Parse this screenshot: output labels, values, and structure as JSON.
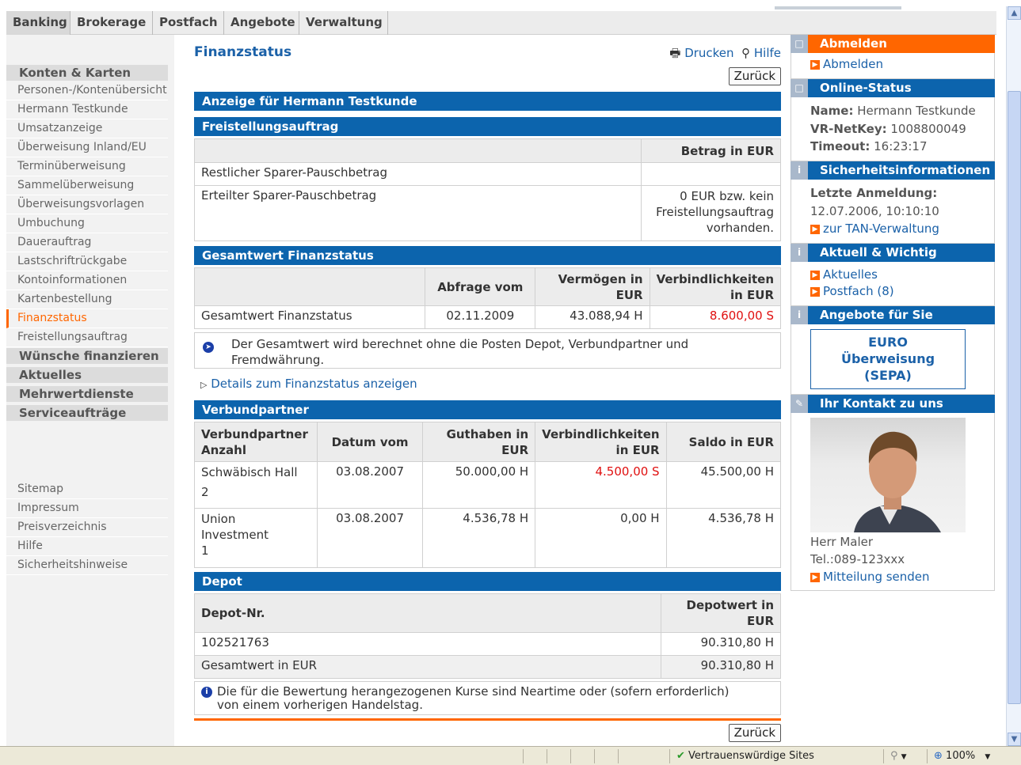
{
  "topnav": {
    "tabs": [
      "Banking",
      "Brokerage",
      "Postfach",
      "Angebote",
      "Verwaltung"
    ]
  },
  "sidebar": {
    "section1": "Konten & Karten",
    "items": [
      "Personen-/Kontenübersicht",
      "Hermann Testkunde",
      "Umsatzanzeige",
      "Überweisung Inland/EU",
      "Terminüberweisung",
      "Sammelüberweisung",
      "Überweisungsvorlagen",
      "Umbuchung",
      "Dauerauftrag",
      "Lastschriftrückgabe",
      "Kontoinformationen",
      "Kartenbestellung",
      "Finanzstatus",
      "Freistellungsauftrag"
    ],
    "active_index": 12,
    "sections": [
      "Wünsche finanzieren",
      "Aktuelles",
      "Mehrwertdienste",
      "Serviceaufträge"
    ],
    "footer_items": [
      "Sitemap",
      "Impressum",
      "Preisverzeichnis",
      "Hilfe",
      "Sicherheitshinweise"
    ]
  },
  "main": {
    "title": "Finanzstatus",
    "print": "Drucken",
    "help": "Hilfe",
    "back": "Zurück",
    "header_bar": "Anzeige für Hermann Testkunde",
    "freistellung": {
      "title": "Freistellungsauftrag",
      "col_betrag": "Betrag in EUR",
      "row1_label": "Restlicher Sparer-Pauschbetrag",
      "row1_value": "",
      "row2_label": "Erteilter Sparer-Pauschbetrag",
      "row2_value_l1": "0 EUR bzw. kein",
      "row2_value_l2": "Freistellungsauftrag",
      "row2_value_l3": "vorhanden."
    },
    "gesamt": {
      "title": "Gesamtwert Finanzstatus",
      "col_abfrage": "Abfrage vom",
      "col_vermoegen_l1": "Vermögen in",
      "col_vermoegen_l2": "EUR",
      "col_verb_l1": "Verbindlichkeiten",
      "col_verb_l2": "in EUR",
      "row_label": "Gesamtwert Finanzstatus",
      "row_date": "02.11.2009",
      "row_vermoegen": "43.088,94 H",
      "row_verb": "8.600,00 S",
      "note_l1": "Der Gesamtwert wird berechnet ohne die Posten Depot, Verbundpartner und",
      "note_l2": "Fremdwährung."
    },
    "details_link": "Details zum Finanzstatus anzeigen",
    "verbund": {
      "title": "Verbundpartner",
      "col1_l1": "Verbundpartner",
      "col1_l2": "Anzahl",
      "col2": "Datum vom",
      "col3_l1": "Guthaben in",
      "col3_l2": "EUR",
      "col4_l1": "Verbindlichkeiten",
      "col4_l2": "in EUR",
      "col5": "Saldo in EUR",
      "r1_name": "Schwäbisch Hall",
      "r1_count": "2",
      "r1_date": "03.08.2007",
      "r1_guthaben": "50.000,00 H",
      "r1_verb": "4.500,00 S",
      "r1_saldo": "45.500,00 H",
      "r2_name_l1": "Union",
      "r2_name_l2": "Investment",
      "r2_count": "1",
      "r2_date": "03.08.2007",
      "r2_guthaben": "4.536,78 H",
      "r2_verb": "0,00 H",
      "r2_saldo": "4.536,78 H"
    },
    "depot": {
      "title": "Depot",
      "col1": "Depot-Nr.",
      "col2_l1": "Depotwert in",
      "col2_l2": "EUR",
      "r1_nr": "102521763",
      "r1_wert": "90.310,80 H",
      "total_label": "Gesamtwert in EUR",
      "total_wert": "90.310,80 H",
      "note_l1": "Die für die Bewertung herangezogenen Kurse sind Neartime oder (sofern erforderlich)",
      "note_l2": "von einem vorherigen Handelstag."
    }
  },
  "right": {
    "abmelden_title": "Abmelden",
    "abmelden_link": "Abmelden",
    "online_title": "Online-Status",
    "name_label": "Name:",
    "name_value": "Hermann Testkunde",
    "netkey_label": "VR-NetKey:",
    "netkey_value": "1008800049",
    "timeout_label": "Timeout:",
    "timeout_value": "16:23:17",
    "sicher_title": "Sicherheitsinformationen",
    "letzte_label": "Letzte Anmeldung:",
    "letzte_value": "12.07.2006, 10:10:10",
    "tan_link": "zur TAN-Verwaltung",
    "aktuell_title": "Aktuell & Wichtig",
    "aktuelles_link": "Aktuelles",
    "postfach_link": "Postfach (8)",
    "angebote_title": "Angebote für Sie",
    "euro_l1": "EURO",
    "euro_l2": "Überweisung",
    "euro_l3": "(SEPA)",
    "kontakt_title": "Ihr Kontakt zu uns",
    "kontakt_name": "Herr Maler",
    "kontakt_tel": "Tel.:089-123xxx",
    "mitteilung_link": "Mitteilung senden"
  },
  "statusbar": {
    "zone": "Vertrauenswürdige Sites",
    "zoom": "100%"
  }
}
